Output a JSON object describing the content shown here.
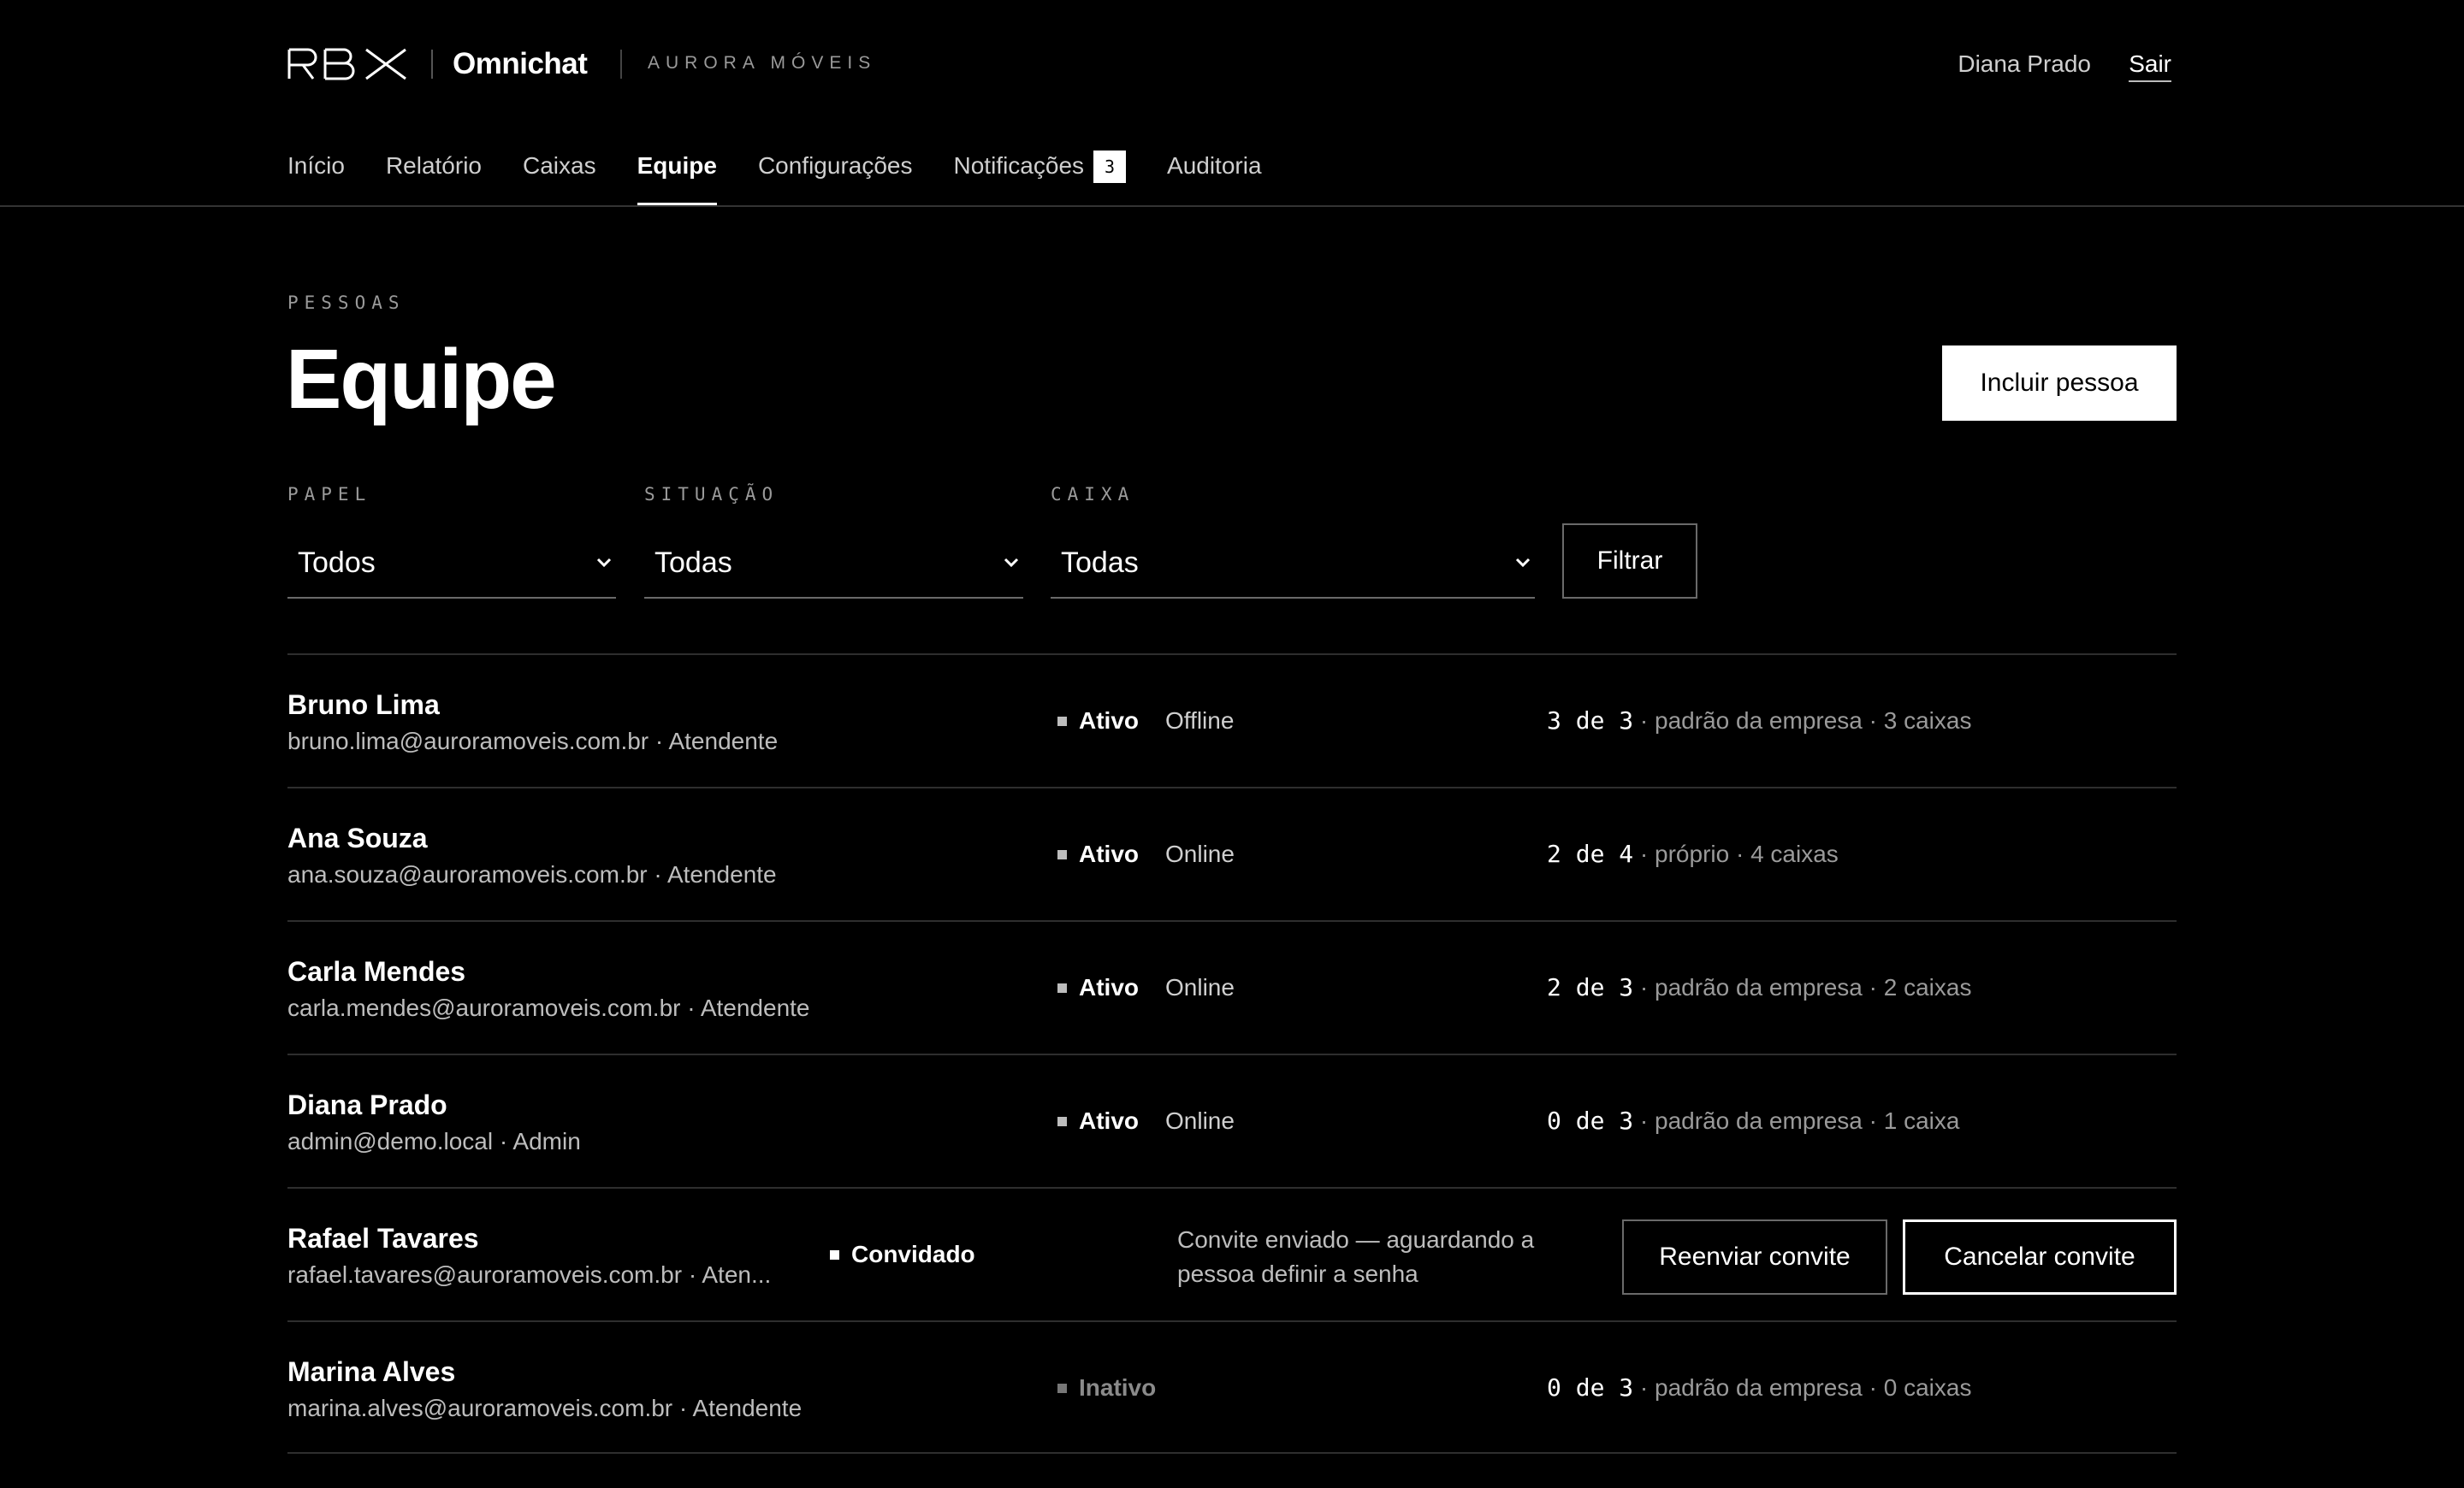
{
  "header": {
    "logo_text": "RBX",
    "app_name": "Omnichat",
    "company": "AURORA MÓVEIS",
    "user_name": "Diana Prado",
    "logout_label": "Sair"
  },
  "nav": {
    "items": [
      {
        "label": "Início"
      },
      {
        "label": "Relatório"
      },
      {
        "label": "Caixas"
      },
      {
        "label": "Equipe",
        "active": true
      },
      {
        "label": "Configurações"
      },
      {
        "label": "Notificações",
        "badge": "3"
      },
      {
        "label": "Auditoria"
      }
    ]
  },
  "page": {
    "eyebrow": "PESSOAS",
    "title": "Equipe",
    "add_button": "Incluir pessoa"
  },
  "filters": {
    "role": {
      "label": "PAPEL",
      "value": "Todos"
    },
    "status": {
      "label": "SITUAÇÃO",
      "value": "Todas"
    },
    "inbox": {
      "label": "CAIXA",
      "value": "Todas"
    },
    "button": "Filtrar"
  },
  "people": [
    {
      "name": "Bruno Lima",
      "sub": "bruno.lima@auroramoveis.com.br · Atendente",
      "status": "Ativo",
      "presence": "Offline",
      "quota": "3 de 3",
      "quota_detail": " · padrão da empresa · 3 caixas"
    },
    {
      "name": "Ana Souza",
      "sub": "ana.souza@auroramoveis.com.br · Atendente",
      "status": "Ativo",
      "presence": "Online",
      "quota": "2 de 4",
      "quota_detail": " · próprio · 4 caixas"
    },
    {
      "name": "Carla Mendes",
      "sub": "carla.mendes@auroramoveis.com.br · Atendente",
      "status": "Ativo",
      "presence": "Online",
      "quota": "2 de 3",
      "quota_detail": " · padrão da empresa · 2 caixas"
    },
    {
      "name": "Diana Prado",
      "sub": "admin@demo.local · Admin",
      "status": "Ativo",
      "presence": "Online",
      "quota": "0 de 3",
      "quota_detail": " · padrão da empresa · 1 caixa"
    },
    {
      "name": "Rafael Tavares",
      "sub": "rafael.tavares@auroramoveis.com.br · Aten...",
      "status": "Convidado",
      "note": "Convite enviado — aguardando a pessoa definir a senha",
      "resend_label": "Reenviar convite",
      "cancel_label": "Cancelar convite"
    },
    {
      "name": "Marina Alves",
      "sub": "marina.alves@auroramoveis.com.br · Atendente",
      "status": "Inativo",
      "quota": "0 de 3",
      "quota_detail": " · padrão da empresa · 0 caixas"
    }
  ]
}
